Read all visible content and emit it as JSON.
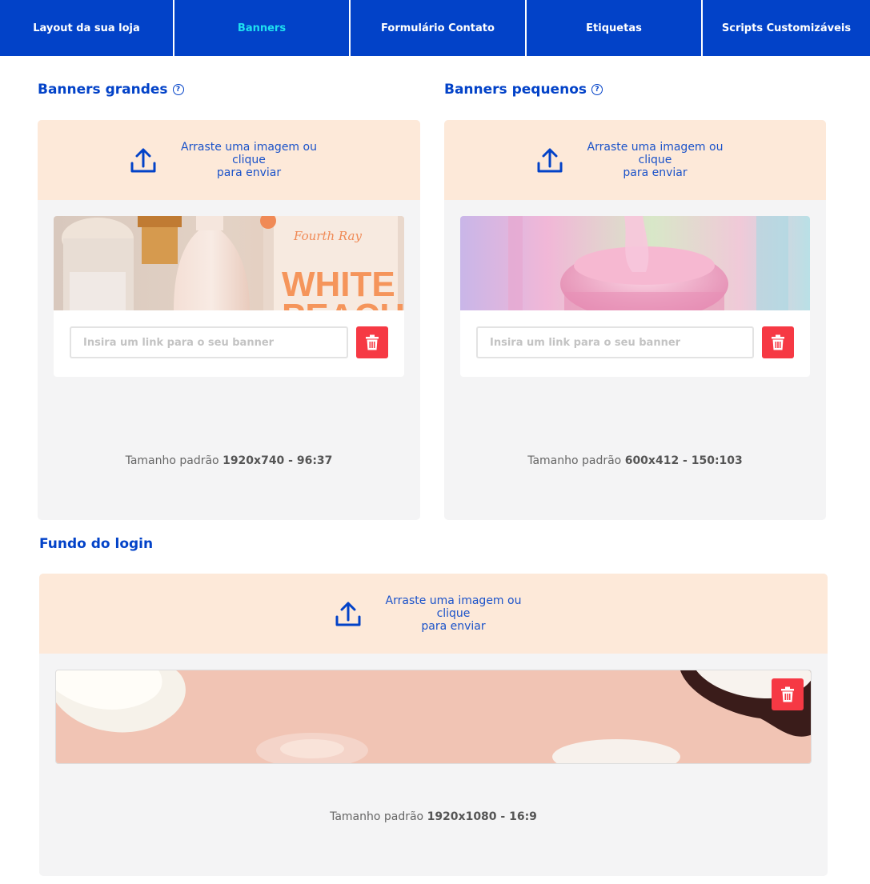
{
  "nav": {
    "tabs": [
      {
        "label": "Layout da sua loja",
        "active": false
      },
      {
        "label": "Banners",
        "active": true
      },
      {
        "label": "Formulário Contato",
        "active": false
      },
      {
        "label": "Etiquetas",
        "active": false
      },
      {
        "label": "Scripts Customizáveis",
        "active": false
      }
    ]
  },
  "large_banners": {
    "title": "Banners grandes",
    "upload": {
      "line1": "Arraste uma imagem ou clique",
      "line2": "para enviar"
    },
    "link_placeholder": "Insira um link para o seu banner",
    "size_label": "Tamanho padrão",
    "size_value": "1920x740 - 96:37",
    "image_text": {
      "brand": "Fourth Ray",
      "line1": "WHITE",
      "line2": "PEACH"
    }
  },
  "small_banners": {
    "title": "Banners pequenos",
    "upload": {
      "line1": "Arraste uma imagem ou clique",
      "line2": "para enviar"
    },
    "link_placeholder": "Insira um link para o seu banner",
    "size_label": "Tamanho padrão",
    "size_value": "600x412 - 150:103"
  },
  "login_background": {
    "title": "Fundo do login",
    "upload": {
      "line1": "Arraste uma imagem ou clique",
      "line2": "para enviar"
    },
    "size_label": "Tamanho padrão",
    "size_value": "1920x1080 - 16:9"
  },
  "colors": {
    "primary": "#0242c8",
    "active_tab_text": "#1ee0f0",
    "dropzone_bg": "#fde9d9",
    "card_bg": "#f4f4f5",
    "delete": "#f63944"
  },
  "icons": {
    "help": "question-circle",
    "upload": "upload-tray-arrow",
    "delete": "trash-can"
  }
}
